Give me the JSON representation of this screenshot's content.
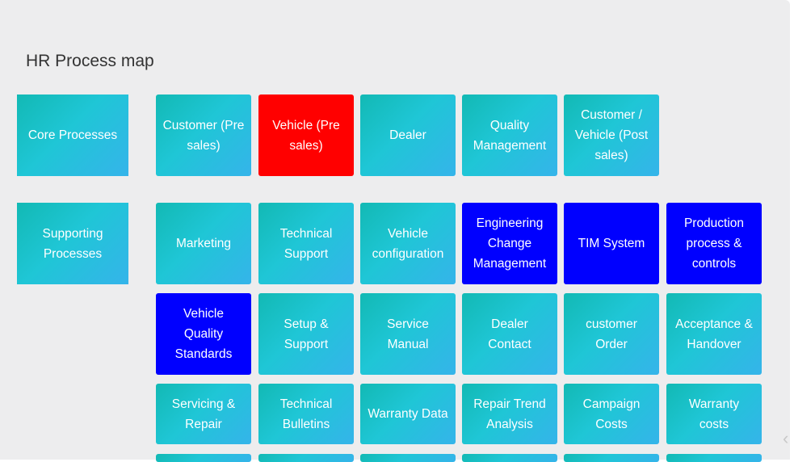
{
  "page": {
    "title": "HR Process map"
  },
  "categories": {
    "core": "Core Processes",
    "supporting": "Supporting Processes"
  },
  "core_tiles": [
    {
      "label": "Customer (Pre sales)",
      "style": "teal"
    },
    {
      "label": "Vehicle (Pre sales)",
      "style": "red"
    },
    {
      "label": "Dealer",
      "style": "teal"
    },
    {
      "label": "Quality Management",
      "style": "teal"
    },
    {
      "label": "Customer / Vehicle (Post sales)",
      "style": "teal"
    }
  ],
  "supporting_rows": [
    [
      {
        "label": "Marketing",
        "style": "teal"
      },
      {
        "label": "Technical Support",
        "style": "teal"
      },
      {
        "label": "Vehicle configuration",
        "style": "teal"
      },
      {
        "label": "Engineering Change Management",
        "style": "blue"
      },
      {
        "label": "TIM System",
        "style": "blue"
      },
      {
        "label": "Production process & controls",
        "style": "blue"
      }
    ],
    [
      {
        "label": "Vehicle Quality Standards",
        "style": "blue"
      },
      {
        "label": "Setup & Support",
        "style": "teal"
      },
      {
        "label": "Service Manual",
        "style": "teal"
      },
      {
        "label": "Dealer Contact",
        "style": "teal"
      },
      {
        "label": "customer Order",
        "style": "teal"
      },
      {
        "label": "Acceptance & Handover",
        "style": "teal"
      }
    ],
    [
      {
        "label": "Servicing & Repair",
        "style": "teal"
      },
      {
        "label": "Technical Bulletins",
        "style": "teal"
      },
      {
        "label": "Warranty Data",
        "style": "teal"
      },
      {
        "label": "Repair Trend Analysis",
        "style": "teal"
      },
      {
        "label": "Campaign Costs",
        "style": "teal"
      },
      {
        "label": "Warranty costs",
        "style": "teal"
      }
    ]
  ],
  "colors": {
    "teal": "#1fc6d6",
    "red": "#ff0000",
    "blue": "#0000ff",
    "panel": "#ededee"
  },
  "icons": {
    "scroll_chevron": "chevron-left-icon"
  }
}
